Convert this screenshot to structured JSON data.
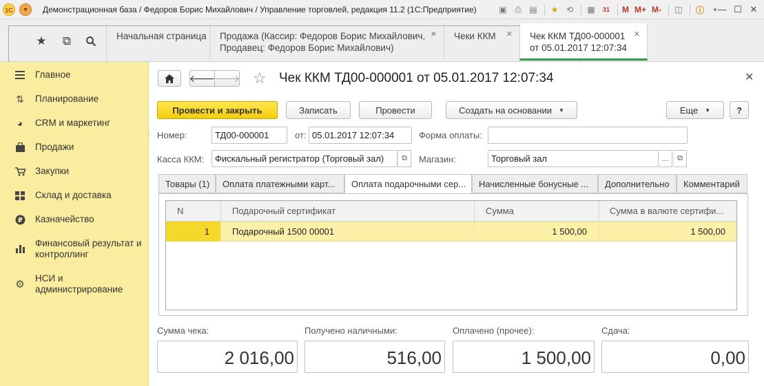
{
  "window": {
    "title": "Демонстрационная база / Федоров Борис Михайлович / Управление торговлей, редакция 11.2  (1С:Предприятие)",
    "logo_text": "1С",
    "toolbar_memory_labels": [
      "M",
      "M+",
      "M-"
    ],
    "calendar_day": "31"
  },
  "tabs": [
    {
      "label": "Начальная страница"
    },
    {
      "label": "Продажа (Кассир: Федоров Борис Михайлович,\nПродавец: Федоров Борис Михайлович)"
    },
    {
      "label": "Чеки ККМ"
    },
    {
      "label": "Чек ККМ ТД00-000001\nот 05.01.2017 12:07:34"
    }
  ],
  "sidebar": {
    "items": [
      {
        "label": "Главное",
        "icon": "menu-lines-icon"
      },
      {
        "label": "Планирование",
        "icon": "planning-icon"
      },
      {
        "label": "CRM и маркетинг",
        "icon": "pie-chart-icon"
      },
      {
        "label": "Продажи",
        "icon": "shopping-bag-icon"
      },
      {
        "label": "Закупки",
        "icon": "cart-icon"
      },
      {
        "label": "Склад и доставка",
        "icon": "warehouse-icon"
      },
      {
        "label": "Казначейство",
        "icon": "ruble-icon"
      },
      {
        "label": "Финансовый результат и контроллинг",
        "icon": "bar-chart-icon"
      },
      {
        "label": "НСИ и администрирование",
        "icon": "gear-icon"
      }
    ]
  },
  "form": {
    "title": "Чек ККМ ТД00-000001 от 05.01.2017 12:07:34",
    "buttons": {
      "post_close": "Провести и закрыть",
      "save": "Записать",
      "post": "Провести",
      "create_based": "Создать на основании",
      "more": "Еще",
      "help": "?"
    },
    "fields": {
      "number_label": "Номер:",
      "number_value": "ТД00-000001",
      "date_label": "от:",
      "date_value": "05.01.2017 12:07:34",
      "payment_form_label": "Форма оплаты:",
      "payment_form_value": "",
      "cash_register_label": "Касса ККМ:",
      "cash_register_value": "Фискальный регистратор (Торговый зал)",
      "store_label": "Магазин:",
      "store_value": "Торговый зал"
    },
    "tabs": [
      {
        "label": "Товары (1)"
      },
      {
        "label": "Оплата платежными карт..."
      },
      {
        "label": "Оплата подарочными сер..."
      },
      {
        "label": "Начисленные бонусные ..."
      },
      {
        "label": "Дополнительно"
      },
      {
        "label": "Комментарий"
      }
    ],
    "active_tab": 2,
    "table": {
      "columns": [
        "N",
        "Подарочный сертификат",
        "Сумма",
        "Сумма в валюте сертифи..."
      ],
      "rows": [
        {
          "n": "1",
          "certificate": "Подарочный 1500 00001",
          "sum": "1 500,00",
          "sum_currency": "1 500,00"
        }
      ]
    },
    "totals": {
      "receipt_sum_label": "Сумма чека:",
      "receipt_sum_value": "2 016,00",
      "cash_received_label": "Получено наличными:",
      "cash_received_value": "516,00",
      "paid_other_label": "Оплачено (прочее):",
      "paid_other_value": "1 500,00",
      "change_label": "Сдача:",
      "change_value": "0,00"
    }
  },
  "colors": {
    "sidebar_bg": "#fbeda0",
    "primary_button": "#f3cd0c",
    "active_tab_underline": "#2f9a47",
    "selected_row": "#fbf0a8"
  }
}
